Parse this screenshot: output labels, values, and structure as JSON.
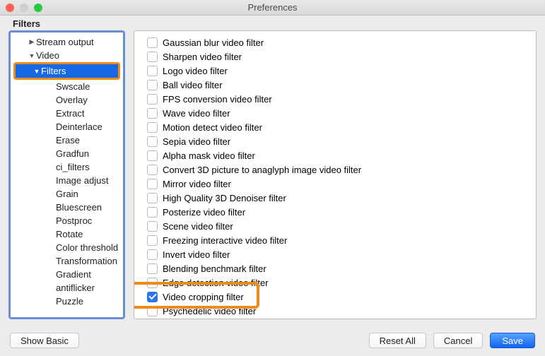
{
  "window": {
    "title": "Preferences"
  },
  "section": {
    "heading": "Filters"
  },
  "sidebar": {
    "items": [
      {
        "label": "Stream output",
        "arrow": "right",
        "indent": 1,
        "selected": false
      },
      {
        "label": "Video",
        "arrow": "down",
        "indent": 1,
        "selected": false
      },
      {
        "label": "Filters",
        "arrow": "down",
        "indent": 1,
        "selected": true,
        "highlightBox": true
      },
      {
        "label": "Swscale",
        "arrow": "",
        "indent": 2,
        "selected": false
      },
      {
        "label": "Overlay",
        "arrow": "",
        "indent": 2,
        "selected": false
      },
      {
        "label": "Extract",
        "arrow": "",
        "indent": 2,
        "selected": false
      },
      {
        "label": "Deinterlace",
        "arrow": "",
        "indent": 2,
        "selected": false
      },
      {
        "label": "Erase",
        "arrow": "",
        "indent": 2,
        "selected": false
      },
      {
        "label": "Gradfun",
        "arrow": "",
        "indent": 2,
        "selected": false
      },
      {
        "label": "ci_filters",
        "arrow": "",
        "indent": 2,
        "selected": false
      },
      {
        "label": "Image adjust",
        "arrow": "",
        "indent": 2,
        "selected": false
      },
      {
        "label": "Grain",
        "arrow": "",
        "indent": 2,
        "selected": false
      },
      {
        "label": "Bluescreen",
        "arrow": "",
        "indent": 2,
        "selected": false
      },
      {
        "label": "Postproc",
        "arrow": "",
        "indent": 2,
        "selected": false
      },
      {
        "label": "Rotate",
        "arrow": "",
        "indent": 2,
        "selected": false
      },
      {
        "label": "Color threshold",
        "arrow": "",
        "indent": 2,
        "selected": false
      },
      {
        "label": "Transformation",
        "arrow": "",
        "indent": 2,
        "selected": false
      },
      {
        "label": "Gradient",
        "arrow": "",
        "indent": 2,
        "selected": false
      },
      {
        "label": "antiflicker",
        "arrow": "",
        "indent": 2,
        "selected": false
      },
      {
        "label": "Puzzle",
        "arrow": "",
        "indent": 2,
        "selected": false
      }
    ]
  },
  "filters": {
    "items": [
      {
        "label": "Gaussian blur video filter",
        "checked": false
      },
      {
        "label": "Sharpen video filter",
        "checked": false
      },
      {
        "label": "Logo video filter",
        "checked": false
      },
      {
        "label": "Ball video filter",
        "checked": false
      },
      {
        "label": "FPS conversion video filter",
        "checked": false
      },
      {
        "label": "Wave video filter",
        "checked": false
      },
      {
        "label": "Motion detect video filter",
        "checked": false
      },
      {
        "label": "Sepia video filter",
        "checked": false
      },
      {
        "label": "Alpha mask video filter",
        "checked": false
      },
      {
        "label": "Convert 3D picture to anaglyph image video filter",
        "checked": false
      },
      {
        "label": "Mirror video filter",
        "checked": false
      },
      {
        "label": "High Quality 3D Denoiser filter",
        "checked": false
      },
      {
        "label": "Posterize video filter",
        "checked": false
      },
      {
        "label": "Scene video filter",
        "checked": false
      },
      {
        "label": "Freezing interactive video filter",
        "checked": false
      },
      {
        "label": "Invert video filter",
        "checked": false
      },
      {
        "label": "Blending benchmark filter",
        "checked": false
      },
      {
        "label": "Edge detection video filter",
        "checked": false
      },
      {
        "label": "Video cropping filter",
        "checked": true,
        "highlightBox": true
      },
      {
        "label": "Psychedelic video filter",
        "checked": false
      }
    ]
  },
  "footer": {
    "showBasic": "Show Basic",
    "resetAll": "Reset All",
    "cancel": "Cancel",
    "save": "Save"
  }
}
